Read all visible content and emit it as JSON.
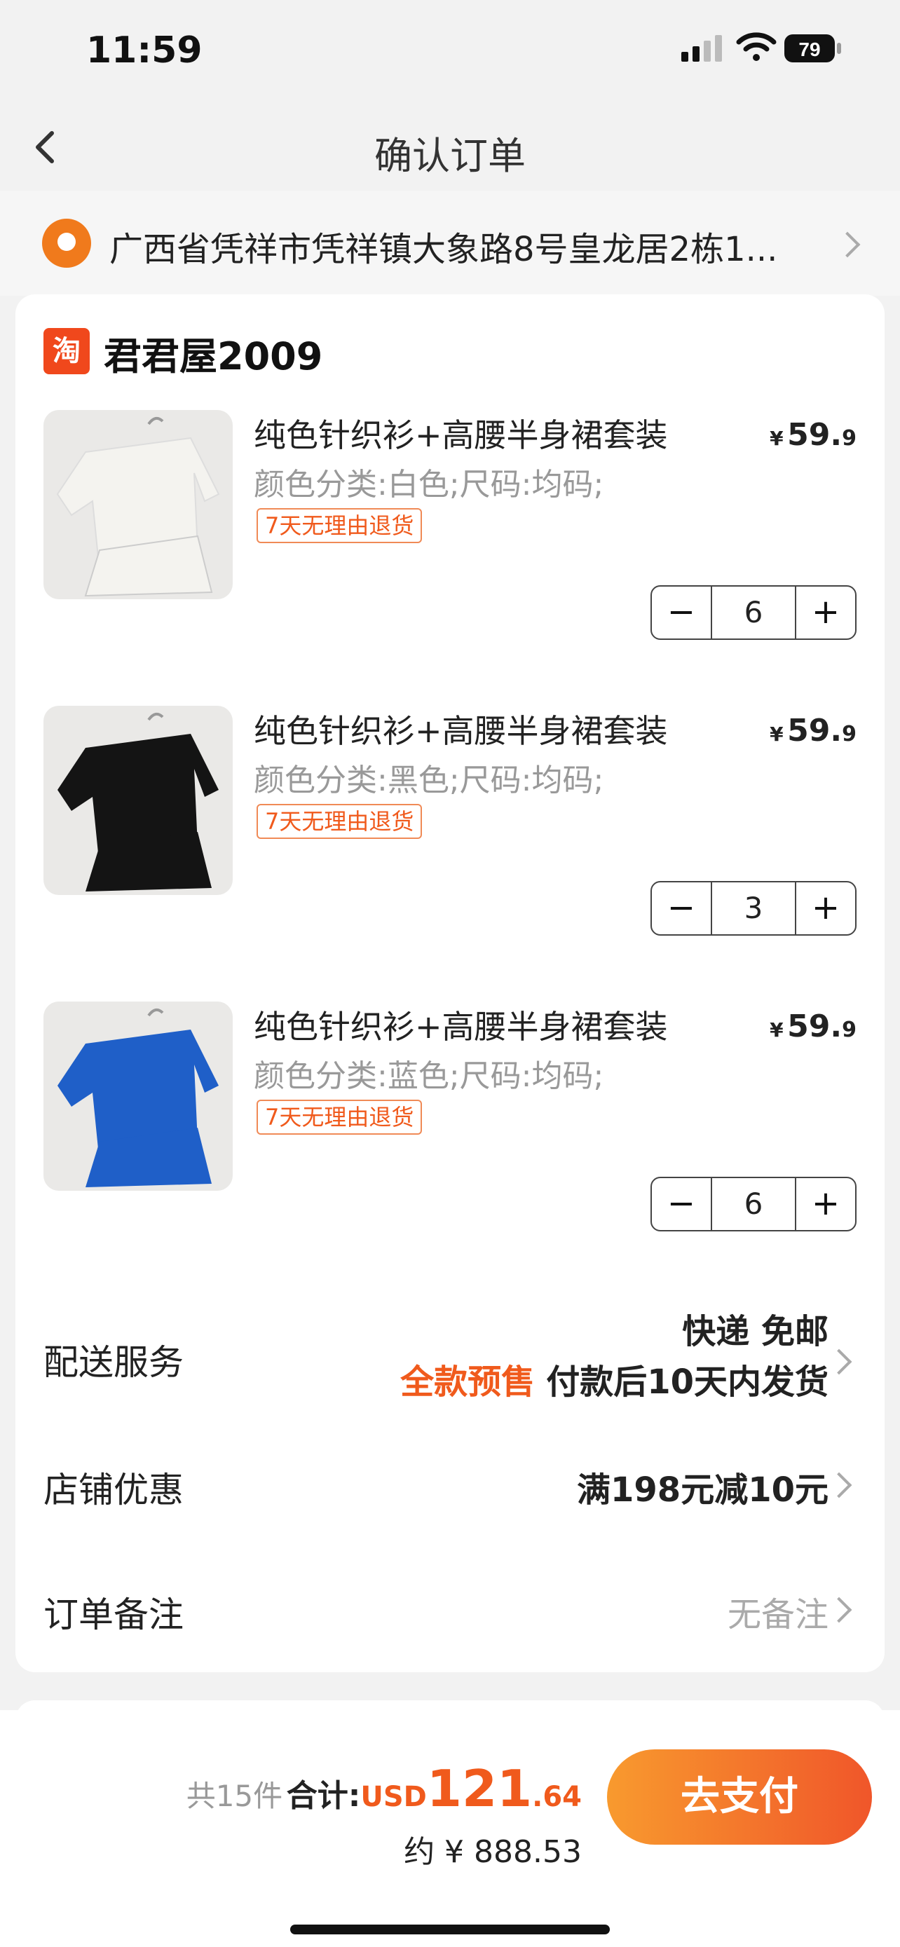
{
  "status_bar": {
    "time": "11:59",
    "battery": "79"
  },
  "nav": {
    "title": "确认订单"
  },
  "address": {
    "text": "广西省凭祥市凭祥镇大象路8号皇龙居2栋1..."
  },
  "shop": {
    "logo_char": "淘",
    "name": "君君屋2009"
  },
  "items": [
    {
      "title": "纯色针织衫+高腰半身裙套装",
      "spec": "颜色分类:白色;尺码:均码;",
      "tag": "7天无理由退货",
      "price_currency": "¥",
      "price_int": "59.",
      "price_dec": "9",
      "qty": "6",
      "color": "#f4f3ef"
    },
    {
      "title": "纯色针织衫+高腰半身裙套装",
      "spec": "颜色分类:黑色;尺码:均码;",
      "tag": "7天无理由退货",
      "price_currency": "¥",
      "price_int": "59.",
      "price_dec": "9",
      "qty": "3",
      "color": "#141414"
    },
    {
      "title": "纯色针织衫+高腰半身裙套装",
      "spec": "颜色分类:蓝色;尺码:均码;",
      "tag": "7天无理由退货",
      "price_currency": "¥",
      "price_int": "59.",
      "price_dec": "9",
      "qty": "6",
      "color": "#1f5fc8"
    }
  ],
  "stepper": {
    "minus": "−",
    "plus": "+"
  },
  "delivery": {
    "label": "配送服务",
    "line1": "快递 免邮",
    "presale": "全款预售",
    "line2": "付款后10天内发货"
  },
  "promo": {
    "label": "店铺优惠",
    "value": "满198元减10元"
  },
  "note": {
    "label": "订单备注",
    "value": "无备注"
  },
  "footer": {
    "count": "共15件",
    "total_label": "合计:",
    "currency": "USD",
    "total_int": "121",
    "total_dec": ".64",
    "approx": "约 ¥ 888.53",
    "pay_button": "去支付"
  },
  "colors": {
    "accent": "#f05a1c",
    "tag_border": "#f08a56",
    "pay_start": "#f89a2e",
    "pay_end": "#f0562a"
  }
}
